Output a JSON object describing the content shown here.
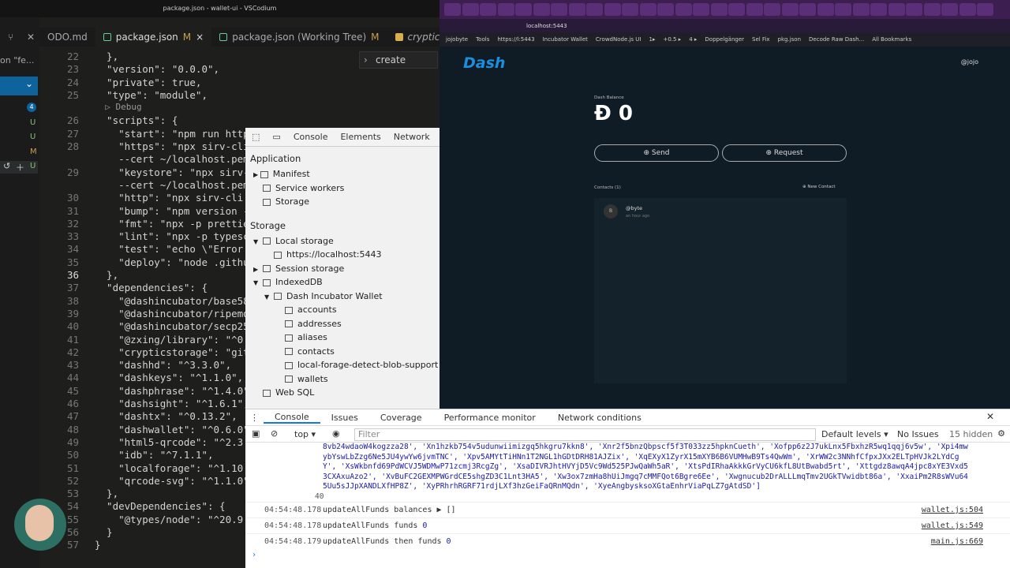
{
  "editor": {
    "title": "package.json - wallet-ui - VSCodium",
    "tabs": [
      {
        "label": "ODO.md"
      },
      {
        "label": "package.json",
        "flag": "M",
        "close": "×"
      },
      {
        "label": "package.json (Working Tree)",
        "flag": "M"
      },
      {
        "label": "cryptic.js"
      }
    ],
    "search_hint": "on \"fe...",
    "create_text": "create",
    "lines": [
      "22",
      "23",
      "24",
      "25",
      "",
      "26",
      "27",
      "28",
      "",
      "29",
      "",
      "30",
      "31",
      "32",
      "33",
      "34",
      "35",
      "36",
      "37",
      "38",
      "39",
      "40",
      "41",
      "42",
      "43",
      "44",
      "45",
      "46",
      "47",
      "48",
      "49",
      "50",
      "51",
      "52",
      "53",
      "54",
      "55",
      "56",
      "57"
    ],
    "code": [
      "  },",
      "  \"version\": \"0.0.0\",",
      "  \"private\": true,",
      "  \"type\": \"module\",",
      "  ▷ Debug",
      "  \"scripts\": {",
      "    \"start\": \"npm run http",
      "    \"https\": \"npx sirv-cli",
      "    --cert ~/localhost.pem",
      "    \"keystore\": \"npx sirv-",
      "    --cert ~/localhost.pem",
      "    \"http\": \"npx sirv-cli",
      "    \"bump\": \"npm version -",
      "    \"fmt\": \"npx -p prettie",
      "    \"lint\": \"npx -p typesc",
      "    \"test\": \"echo \\\"Error:",
      "    \"deploy\": \"node .githu",
      "  },",
      "  \"dependencies\": {",
      "    \"@dashincubator/base58",
      "    \"@dashincubator/ripemd",
      "    \"@dashincubator/secp25",
      "    \"@zxing/library\": \"^0.",
      "    \"crypticstorage\": \"git",
      "    \"dashhd\": \"^3.3.0\",",
      "    \"dashkeys\": \"^1.1.0\",",
      "    \"dashphrase\": \"^1.4.0\"",
      "    \"dashsight\": \"^1.6.1\",",
      "    \"dashtx\": \"^0.13.2\",",
      "    \"dashwallet\": \"^0.6.0\"",
      "    \"html5-qrcode\": \"^2.3.",
      "    \"idb\": \"^7.1.1\",",
      "    \"localforage\": \"^1.10.",
      "    \"qrcode-svg\": \"^1.1.0\"",
      "  },",
      "  \"devDependencies\": {",
      "    \"@types/node\": \"^20.9.",
      "  }",
      "}"
    ],
    "scm_badge": "4",
    "scm_letters": [
      "U",
      "U",
      "M",
      "U"
    ]
  },
  "app_devtools": {
    "tabs": [
      "Console",
      "Elements",
      "Network"
    ],
    "application_header": "Application",
    "application_items": [
      "Manifest",
      "Service workers",
      "Storage"
    ],
    "storage_header": "Storage",
    "storage_items": [
      {
        "label": "Local storage",
        "indent": 0,
        "arrow": "▼"
      },
      {
        "label": "https://localhost:5443",
        "indent": 1,
        "arrow": ""
      },
      {
        "label": "Session storage",
        "indent": 0,
        "arrow": "▶"
      },
      {
        "label": "IndexedDB",
        "indent": 0,
        "arrow": "▼"
      },
      {
        "label": "Dash Incubator Wallet",
        "indent": 1,
        "arrow": "▼"
      },
      {
        "label": "accounts",
        "indent": 2,
        "arrow": ""
      },
      {
        "label": "addresses",
        "indent": 2,
        "arrow": ""
      },
      {
        "label": "aliases",
        "indent": 2,
        "arrow": ""
      },
      {
        "label": "contacts",
        "indent": 2,
        "arrow": ""
      },
      {
        "label": "local-forage-detect-blob-support",
        "indent": 2,
        "arrow": ""
      },
      {
        "label": "wallets",
        "indent": 2,
        "arrow": ""
      },
      {
        "label": "Web SQL",
        "indent": 0,
        "arrow": ""
      }
    ]
  },
  "browser": {
    "url": "localhost:5443",
    "bookmarks": [
      "jojobyte",
      "Tools",
      "https://l:5443",
      "Incubator Wallet",
      "CrowdNode.js UI",
      "1▸",
      "+0.5 ▸",
      "4 ▸",
      "Doppelgänger",
      "Sel Fix",
      "pkg.json",
      "Decode Raw Dash...",
      "All Bookmarks"
    ]
  },
  "wallet": {
    "logo": "Dash",
    "user": "@jojo",
    "balance_label": "Dash Balance",
    "balance": "Đ 0",
    "send": "⊕ Send",
    "request": "⊕ Request",
    "contacts_label": "Contacts (1)",
    "new_contact": "⊕ New Contact",
    "contact_initial": "B",
    "contact_name": "@byte",
    "contact_time": "an hour ago"
  },
  "console": {
    "tabs": [
      "Console",
      "Issues",
      "Coverage",
      "Performance monitor",
      "Network conditions"
    ],
    "context": "top ▾",
    "filter_placeholder": "Filter",
    "levels": "Default levels ▾",
    "no_issues": "No Issues",
    "hidden": "15 hidden",
    "array_lines": [
      "8vb24wdaoW4kogzza28', 'Xn1hzkb754v5udunwiimizgq5hkgru7kkn8', 'Xnr2f5bnzQbpscf5f3T033zz5hpknCueth', 'Xofpp6z2J7ukLnx5FbxhzR5wq1qqj6v5w', 'Xpi4mw",
      "ybYswLbZzg6Ne5JU4ywYw6jvmTNC', 'Xpv5AMYtTiHNn1T2NGL1hGDtDRH81AJZix', 'XqEXyX1ZyrX15mXYB6B6VUMHwB9Ts4QwWm', 'XrWW2c3NNhfCfpxJXx2ELTpHVJk2LYdCg",
      "Y', 'XsWkbnfd69PdWCVJ5WDMwP71zcmj3RcgZg', 'XsaDIVRJhtHVYjD5Vc9Wd525PJwQaWh5aR', 'XtsPdIRhaAkkkGrVyCU6kfL8UtBwabd5rt', 'Xttgdz8awqA4jpc8xYE3Vxd5",
      "3CXAxuAzo2', 'XvBuFC2GEXMPWGrdCE5shgZD3C1Lnt3HA5', 'Xw3ox7zmHa8hUiJmgq7cMMFQot6Bgre6Ee', 'Xwgnucub2DrALLLmqTmv2UGkTVwidbt86a', 'XxaiPm2R8sWVu64",
      "5Uu5sJJpXANDLXfHP8Z', 'XyPRhrhRGRF71rdjLXf3hzGeiFaQRnMQdn', 'XyeAngbysksoXGtaEnhrViaPqLZ7gAtdSD']"
    ],
    "array_count": "40",
    "logs": [
      {
        "ts": "04:54:48.178",
        "msg": "updateAllFunds balances ▶ []",
        "src": "wallet.js:504"
      },
      {
        "ts": "04:54:48.178",
        "msg": "updateAllFunds funds",
        "val": "0",
        "src": "wallet.js:549"
      },
      {
        "ts": "04:54:48.179",
        "msg": "updateAllFunds then funds",
        "val": "0",
        "src": "main.js:669"
      }
    ],
    "prompt": "›"
  }
}
